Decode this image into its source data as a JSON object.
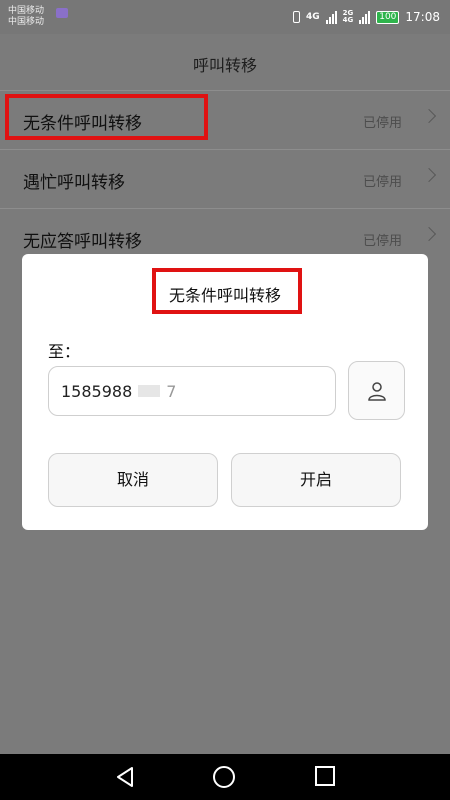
{
  "status_bar": {
    "carrier1": "中国移动",
    "carrier2": "中国移动",
    "network1": "4G",
    "network2": "2G",
    "network2b": "4G",
    "battery": "100",
    "time": "17:08"
  },
  "appbar": {
    "title": "呼叫转移"
  },
  "rows": [
    {
      "label": "无条件呼叫转移",
      "status": "已停用"
    },
    {
      "label": "遇忙呼叫转移",
      "status": "已停用"
    },
    {
      "label": "无应答呼叫转移",
      "status": "已停用"
    }
  ],
  "dialog": {
    "title": "无条件呼叫转移",
    "to_label": "至：",
    "phone_value": "1585988",
    "phone_suffix": "7",
    "cancel_label": "取消",
    "enable_label": "开启"
  },
  "colors": {
    "highlight": "#e01212",
    "overlay": "#7b7b7b"
  }
}
